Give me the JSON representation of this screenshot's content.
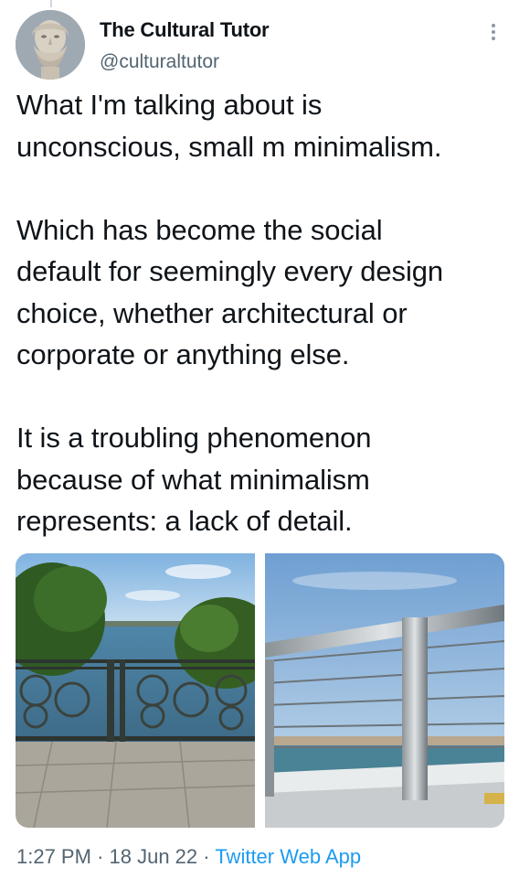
{
  "author": {
    "display_name": "The Cultural Tutor",
    "handle": "@culturaltutor",
    "avatar_icon": "classical-bust-avatar"
  },
  "more_icon": "more-options-icon",
  "tweet": {
    "paragraphs": [
      [
        "What I'm talking about is",
        "unconscious, small m minimalism."
      ],
      [
        "Which has become the social",
        "default for seemingly every design",
        "choice, whether architectural or",
        "corporate or anything else."
      ],
      [
        "It is a troubling phenomenon",
        "because of what minimalism",
        "represents: a lack of detail."
      ]
    ]
  },
  "media": [
    {
      "name": "ornate-iron-railing-photo"
    },
    {
      "name": "steel-cable-railing-photo"
    }
  ],
  "meta": {
    "time": "1:27 PM",
    "separator": "·",
    "date": "18 Jun 22",
    "source": "Twitter Web App"
  },
  "colors": {
    "text": "#0f1419",
    "secondary": "#536471",
    "link": "#1d9bf0"
  }
}
